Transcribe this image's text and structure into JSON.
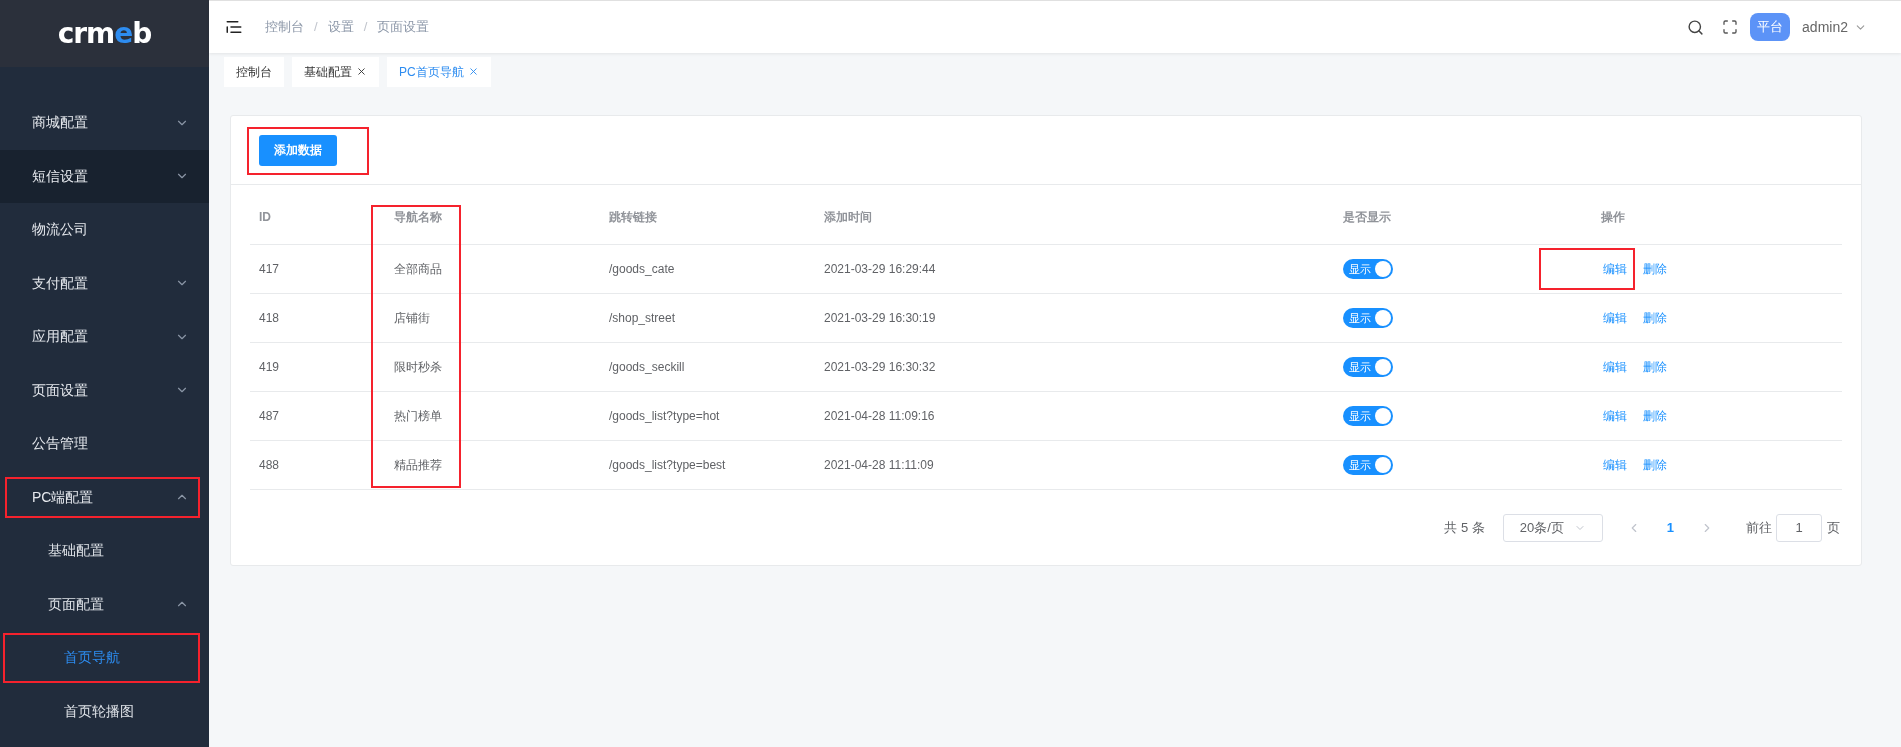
{
  "sidebar": {
    "items": [
      {
        "label": "商城配置",
        "kind": "top",
        "expanded": false,
        "selected": false,
        "hovered": false,
        "highlighted": false
      },
      {
        "label": "短信设置",
        "kind": "top",
        "expanded": false,
        "selected": false,
        "hovered": true,
        "highlighted": false
      },
      {
        "label": "物流公司",
        "kind": "leaf",
        "selected": false,
        "hovered": false,
        "highlighted": false
      },
      {
        "label": "支付配置",
        "kind": "top",
        "expanded": false,
        "selected": false,
        "hovered": false,
        "highlighted": false
      },
      {
        "label": "应用配置",
        "kind": "top",
        "expanded": false,
        "selected": false,
        "hovered": false,
        "highlighted": false
      },
      {
        "label": "页面设置",
        "kind": "top",
        "expanded": false,
        "selected": false,
        "hovered": false,
        "highlighted": false
      },
      {
        "label": "公告管理",
        "kind": "leaf",
        "selected": false,
        "hovered": false,
        "highlighted": false
      },
      {
        "label": "PC端配置",
        "kind": "top",
        "expanded": true,
        "selected": false,
        "hovered": false,
        "highlighted": true,
        "children": [
          {
            "label": "基础配置",
            "kind": "leaf",
            "selected": false,
            "hovered": false,
            "highlighted": false
          },
          {
            "label": "页面配置",
            "kind": "top",
            "expanded": true,
            "selected": false,
            "hovered": false,
            "highlighted": false,
            "children": [
              {
                "label": "首页导航",
                "kind": "leaf",
                "selected": true,
                "hovered": false,
                "highlighted": true
              },
              {
                "label": "首页轮播图",
                "kind": "leaf",
                "selected": false,
                "hovered": false,
                "highlighted": false
              }
            ]
          }
        ]
      }
    ]
  },
  "logo": [
    {
      "text": "crm",
      "color": "#ffffff"
    },
    {
      "text": "e",
      "color": "#2d8cf0"
    },
    {
      "text": "b",
      "color": "#ffffff"
    }
  ],
  "breadcrumb": {
    "separator": "/",
    "items": [
      "控制台",
      "设置",
      "页面设置"
    ]
  },
  "header": {
    "badge": "平台",
    "user": "admin2"
  },
  "tabs": [
    {
      "label": "控制台",
      "selected": false,
      "closable": false
    },
    {
      "label": "基础配置",
      "selected": false,
      "closable": true
    },
    {
      "label": "PC首页导航",
      "selected": true,
      "closable": true
    }
  ],
  "add_button": {
    "label": "添加数据",
    "highlighted": true
  },
  "table": {
    "columns": [
      {
        "label": "ID",
        "highlighted": false
      },
      {
        "label": "导航名称",
        "highlighted": true
      },
      {
        "label": "跳转链接",
        "highlighted": false
      },
      {
        "label": "添加时间",
        "highlighted": false
      },
      {
        "label": "是否显示",
        "highlighted": false
      },
      {
        "label": "操作",
        "highlighted": false
      }
    ],
    "rows": [
      {
        "id": "417",
        "name": "全部商品",
        "link": "/goods_cate",
        "time": "2021-03-29 16:29:44",
        "toggle": "显示",
        "on": true,
        "edit": "编辑",
        "delete": "删除",
        "edit_highlighted": true
      },
      {
        "id": "418",
        "name": "店铺街",
        "link": "/shop_street",
        "time": "2021-03-29 16:30:19",
        "toggle": "显示",
        "on": true,
        "edit": "编辑",
        "delete": "删除",
        "edit_highlighted": false
      },
      {
        "id": "419",
        "name": "限时秒杀",
        "link": "/goods_seckill",
        "time": "2021-03-29 16:30:32",
        "toggle": "显示",
        "on": true,
        "edit": "编辑",
        "delete": "删除",
        "edit_highlighted": false
      },
      {
        "id": "487",
        "name": "热门榜单",
        "link": "/goods_list?type=hot",
        "time": "2021-04-28 11:09:16",
        "toggle": "显示",
        "on": true,
        "edit": "编辑",
        "delete": "删除",
        "edit_highlighted": false
      },
      {
        "id": "488",
        "name": "精品推荐",
        "link": "/goods_list?type=best",
        "time": "2021-04-28 11:11:09",
        "toggle": "显示",
        "on": true,
        "edit": "编辑",
        "delete": "删除",
        "edit_highlighted": false
      }
    ]
  },
  "pagination": {
    "total": "共 5 条",
    "page_size": "20条/页",
    "pages": [
      {
        "label": "1",
        "selected": true
      }
    ],
    "goto_label": "前往",
    "goto_value": "1",
    "goto_suffix": "页"
  }
}
